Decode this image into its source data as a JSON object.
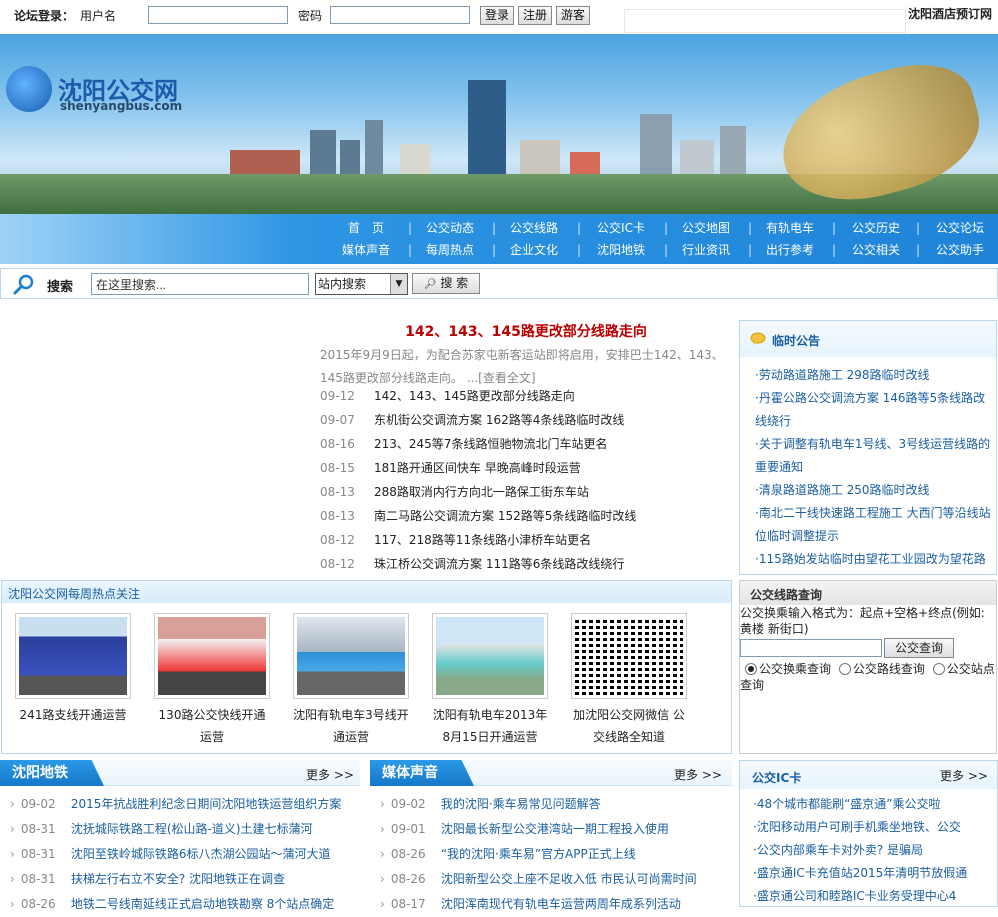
{
  "login": {
    "label": "论坛登录：",
    "username_label": "用户名",
    "password_label": "密码",
    "login_btn": "登录",
    "register_btn": "注册",
    "guest_btn": "游客",
    "hotel_link": "沈阳酒店预订网"
  },
  "logo": {
    "cn": "沈阳公交网",
    "en": "shenyangbus.com"
  },
  "nav": {
    "row1": [
      "首　页",
      "公交动态",
      "公交线路",
      "公交IC卡",
      "公交地图",
      "有轨电车",
      "公交历史",
      "公交论坛"
    ],
    "row2": [
      "媒体声音",
      "每周热点",
      "企业文化",
      "沈阳地铁",
      "行业资讯",
      "出行参考",
      "公交相关",
      "公交助手"
    ]
  },
  "search": {
    "label": "搜索",
    "placeholder": "在这里搜索...",
    "scope": "站内搜索",
    "button": "搜 索"
  },
  "headline": {
    "title": "142、143、145路更改部分线路走向",
    "summary": "2015年9月9日起，为配合苏家屯新客运站即将启用，安排巴士142、143、145路更改部分线路走向。",
    "more": "...[查看全文]"
  },
  "news": [
    {
      "date": "09-12",
      "title": "142、143、145路更改部分线路走向"
    },
    {
      "date": "09-07",
      "title": "东机街公交调流方案  162路等4条线路临时改线"
    },
    {
      "date": "08-16",
      "title": "213、245等7条线路恒驰物流北门车站更名"
    },
    {
      "date": "08-15",
      "title": "181路开通区间快车 早晚高峰时段运营"
    },
    {
      "date": "08-13",
      "title": "288路取消内行方向北一路保工街东车站"
    },
    {
      "date": "08-13",
      "title": "南二马路公交调流方案  152路等5条线路临时改线"
    },
    {
      "date": "08-12",
      "title": "117、218路等11条线路小津桥车站更名"
    },
    {
      "date": "08-12",
      "title": "珠江桥公交调流方案  111路等6条线路改线绕行"
    }
  ],
  "notice": {
    "title": "临时公告",
    "items": [
      "·劳动路道路施工  298路临时改线",
      "·丹霍公路公交调流方案  146路等5条线路改线绕行",
      "·关于调整有轨电车1号线、3号线运营线路的重要通知",
      "·清泉路道路施工  250路临时改线",
      "·南北二干线快速路工程施工 大西门等沿线站位临时调整提示",
      "·115路始发站临时由望花工业园改为望花路"
    ]
  },
  "hot": {
    "title": "沈阳公交网每周热点关注",
    "items": [
      {
        "caption": "241路支线开通运营"
      },
      {
        "caption": "130路公交快线开通运营"
      },
      {
        "caption": "沈阳有轨电车3号线开通运营"
      },
      {
        "caption": "沈阳有轨电车2013年8月15日开通运营"
      },
      {
        "caption": "加沈阳公交网微信 公交线路全知道"
      }
    ]
  },
  "route": {
    "title": "公交线路查询",
    "hint": "公交换乘输入格式为：起点+空格+终点(例如:黄楼 新街口)",
    "button": "公交查询",
    "options": [
      "公交换乘查询",
      "公交路线查询",
      "公交站点查询"
    ]
  },
  "metro": {
    "title": "沈阳地铁",
    "more": "更多 >>",
    "items": [
      {
        "date": "09-02",
        "title": "2015年抗战胜利纪念日期间沈阳地铁运营组织方案"
      },
      {
        "date": "08-31",
        "title": "沈抚城际铁路工程(松山路-道义)土建七标蒲河"
      },
      {
        "date": "08-31",
        "title": "沈阳至铁岭城际铁路6标八杰湖公园站～蒲河大道"
      },
      {
        "date": "08-31",
        "title": "扶梯左行右立不安全? 沈阳地铁正在调查"
      },
      {
        "date": "08-26",
        "title": "地铁二号线南延线正式启动地铁勘察 8个站点确定"
      }
    ]
  },
  "media": {
    "title": "媒体声音",
    "more": "更多 >>",
    "items": [
      {
        "date": "09-02",
        "title": "我的沈阳·乘车易常见问题解答"
      },
      {
        "date": "09-01",
        "title": "沈阳最长新型公交港湾站一期工程投入使用"
      },
      {
        "date": "08-26",
        "title": "“我的沈阳·乘车易”官方APP正式上线"
      },
      {
        "date": "08-26",
        "title": "沈阳新型公交上座不足收入低 市民认可尚需时间"
      },
      {
        "date": "08-17",
        "title": "沈阳浑南现代有轨电车运营两周年成系列活动"
      }
    ]
  },
  "ic": {
    "title": "公交IC卡",
    "more": "更多 >>",
    "items": [
      "·48个城市都能刷“盛京通”乘公交啦",
      "·沈阳移动用户可刷手机乘坐地铁、公交",
      "·公交内部乘车卡对外卖? 是骗局",
      "·盛京通IC卡充值站2015年清明节放假通",
      "·盛京通公司和睦路IC卡业务受理中心4"
    ]
  }
}
